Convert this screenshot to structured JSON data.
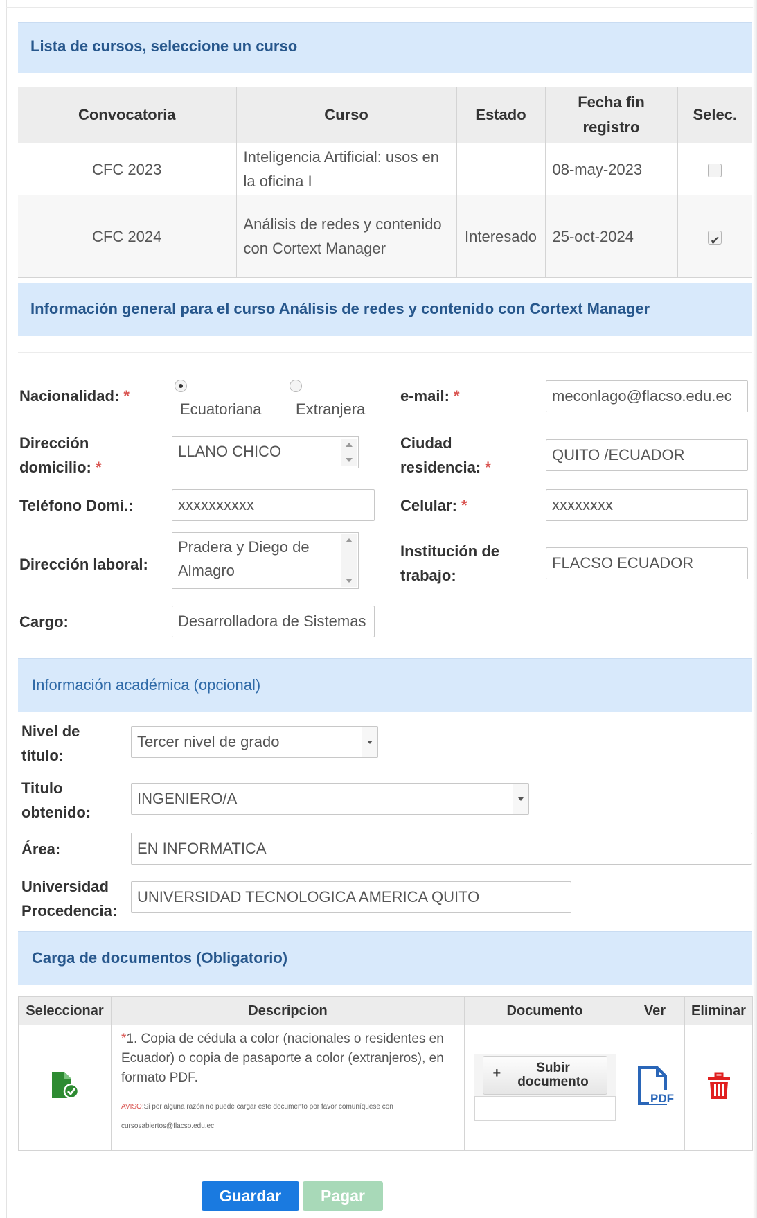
{
  "courses_panel": {
    "title": "Lista de cursos, seleccione un curso"
  },
  "courses_table": {
    "headers": [
      "Convocatoria",
      "Curso",
      "Estado",
      "Fecha fin registro",
      "Selec."
    ],
    "rows": [
      {
        "convocatoria": "CFC 2023",
        "curso": "Inteligencia Artificial: usos en la oficina I",
        "estado": "",
        "fecha": "08-may-2023",
        "selected": false
      },
      {
        "convocatoria": "CFC 2024",
        "curso": "Análisis de redes y contenido con Cortext Manager",
        "estado": "Interesado",
        "fecha": "25-oct-2024",
        "selected": true
      }
    ]
  },
  "general_panel": {
    "title": "Información general para el curso Análisis de redes y contenido con Cortext Manager"
  },
  "form": {
    "nacionalidad": {
      "label": "Nacionalidad:",
      "options": [
        "Ecuatoriana",
        "Extranjera"
      ],
      "selected": "Ecuatoriana"
    },
    "email": {
      "label": "e-mail:",
      "value": "meconlago@flacso.edu.ec"
    },
    "direccion_domicilio": {
      "label_1": "Dirección",
      "label_2": "domicilio:",
      "value": "LLANO CHICO"
    },
    "ciudad_residencia": {
      "label_1": "Ciudad",
      "label_2": "residencia:",
      "value": "QUITO  /ECUADOR"
    },
    "telefono": {
      "label": "Teléfono Domi.:",
      "value": "xxxxxxxxxx"
    },
    "celular": {
      "label": "Celular:",
      "value": "xxxxxxxx"
    },
    "direccion_laboral": {
      "label": "Dirección laboral:",
      "value": "Pradera y Diego de Almagro"
    },
    "institucion": {
      "label_1": "Institución de",
      "label_2": "trabajo:",
      "value": "FLACSO ECUADOR"
    },
    "cargo": {
      "label": "Cargo:",
      "value": "Desarrolladora de Sistemas"
    },
    "required_mark": "*"
  },
  "academic_panel": {
    "title": "Información académica (opcional)"
  },
  "academic": {
    "nivel": {
      "label_1": "Nivel de",
      "label_2": "título:",
      "value": "Tercer nivel de grado"
    },
    "titulo": {
      "label_1": "Titulo",
      "label_2": "obtenido:",
      "value": "INGENIERO/A"
    },
    "area": {
      "label": "Área:",
      "value": "EN INFORMATICA"
    },
    "universidad": {
      "label_1": "Universidad",
      "label_2": "Procedencia:",
      "value": "UNIVERSIDAD TECNOLOGICA AMERICA  QUITO"
    }
  },
  "docs_panel": {
    "title": "Carga de documentos (Obligatorio)"
  },
  "docs_table": {
    "headers": [
      "Seleccionar",
      "Descripcion",
      "Documento",
      "Ver",
      "Eliminar"
    ],
    "row": {
      "star": "*",
      "description": "1. Copia de cédula a color (nacionales o residentes en Ecuador) o copia de pasaporte a color (extranjeros), en formato PDF.",
      "aviso_tag": "AVISO:",
      "aviso_text": "Si por alguna razón no puede cargar este documento por favor comuníquese con cursosabiertos@flacso.edu.ec",
      "upload_plus": "+",
      "upload_label_1": "Subir",
      "upload_label_2": "documento",
      "pdf_label": "PDF"
    }
  },
  "buttons": {
    "guardar": "Guardar",
    "pagar": "Pagar"
  },
  "colors": {
    "panel_bg": "#d8e9fb",
    "panel_title": "#27578c",
    "required": "#d9534f",
    "guardar": "#1a7ae0",
    "pagar": "#a8d9b8",
    "delete": "#e02020",
    "file_icon": "#2e8b32",
    "pdf_icon": "#2a66b8"
  },
  "icons": {
    "select_file": "file-check-icon",
    "view": "pdf-icon",
    "delete": "trash-icon"
  }
}
